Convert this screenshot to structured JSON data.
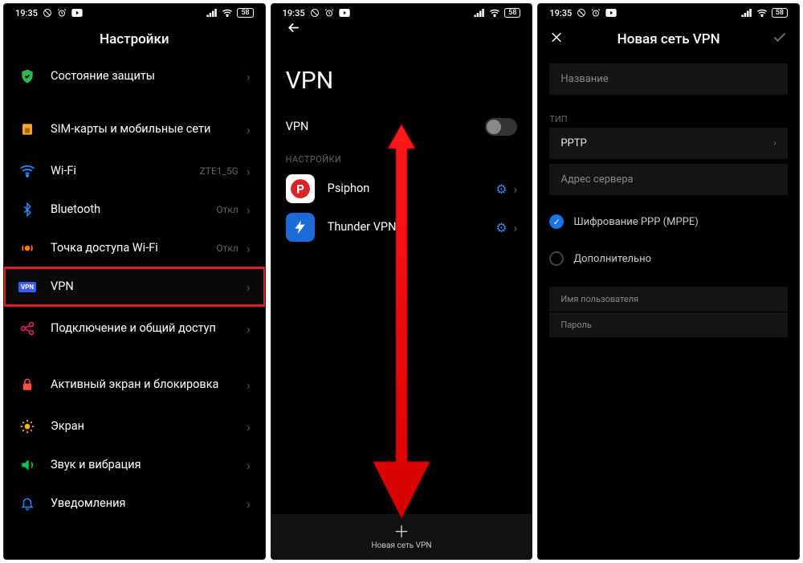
{
  "status": {
    "time": "19:35",
    "battery": "58"
  },
  "screen1": {
    "title": "Настройки",
    "items": [
      {
        "label": "Состояние защиты",
        "status": "",
        "twoline": false
      },
      {
        "label": "SIM-карты и мобильные сети",
        "status": "",
        "twoline": true
      },
      {
        "label": "Wi-Fi",
        "status": "ZTE1_5G",
        "twoline": false
      },
      {
        "label": "Bluetooth",
        "status": "Откл",
        "twoline": false
      },
      {
        "label": "Точка доступа Wi-Fi",
        "status": "Откл",
        "twoline": false
      },
      {
        "label": "VPN",
        "status": "",
        "twoline": false
      },
      {
        "label": "Подключение и общий доступ",
        "status": "",
        "twoline": true
      },
      {
        "label": "Активный экран и блокировка",
        "status": "",
        "twoline": true
      },
      {
        "label": "Экран",
        "status": "",
        "twoline": false
      },
      {
        "label": "Звук и вибрация",
        "status": "",
        "twoline": false
      },
      {
        "label": "Уведомления",
        "status": "",
        "twoline": false
      }
    ]
  },
  "screen2": {
    "title": "VPN",
    "toggle_label": "VPN",
    "section": "НАСТРОЙКИ",
    "apps": [
      {
        "label": "Psiphon"
      },
      {
        "label": "Thunder VPN"
      }
    ],
    "add_label": "Новая сеть VPN"
  },
  "screen3": {
    "title": "Новая сеть VPN",
    "name_placeholder": "Название",
    "type_label": "ТИП",
    "type_value": "PPTP",
    "server_placeholder": "Адрес сервера",
    "encrypt_label": "Шифрование PPP (MPPE)",
    "extra_label": "Дополнительно",
    "user_label": "Имя пользователя",
    "pass_label": "Пароль"
  }
}
